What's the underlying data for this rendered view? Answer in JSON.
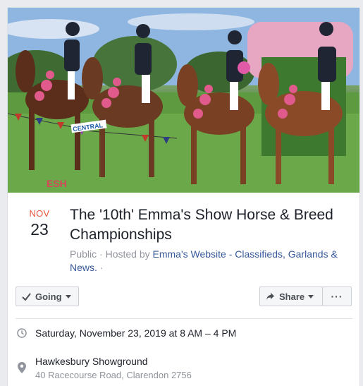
{
  "cover": {
    "watermark": "ESH",
    "banner_text": "CENTRAL"
  },
  "date": {
    "month": "NOV",
    "day": "23"
  },
  "event": {
    "title": "The '10th' Emma's Show Horse & Breed Championships",
    "visibility": "Public",
    "hosted_prefix": " · Hosted by ",
    "host": "Emma's Website - Classifieds, Garlands & News.",
    "trailing": " ·"
  },
  "actions": {
    "going_label": "Going",
    "share_label": "Share",
    "more_label": "···"
  },
  "details": {
    "datetime": "Saturday, November 23, 2019 at 8 AM – 4 PM",
    "venue": "Hawkesbury Showground",
    "address": "40 Racecourse Road, Clarendon 2756"
  },
  "colors": {
    "month": "#e9573f",
    "link": "#365899",
    "muted": "#90949c"
  }
}
